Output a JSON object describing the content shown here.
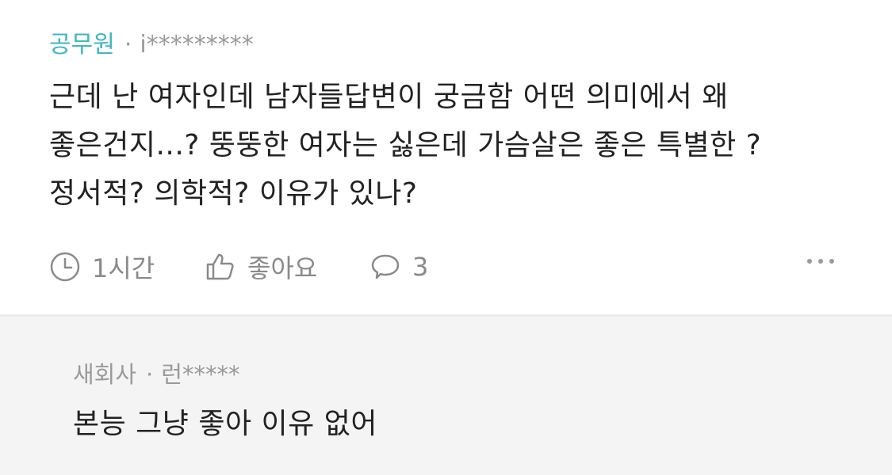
{
  "post": {
    "author_job": "공무원",
    "separator": "·",
    "author_id": "i*********",
    "body_lines": [
      "근데 난 여자인데 남자들답변이 궁금함 어떤 의미에서 왜",
      "좋은건지...? 뚱뚱한 여자는 싫은데 가슴살은 좋은 특별한 ?",
      "정서적? 의학적? 이유가 있나?"
    ],
    "time": "1시간",
    "like_label": "좋아요",
    "comment_count": "3",
    "icons": {
      "time": "clock-icon",
      "like": "thumbs-up-icon",
      "comment": "speech-bubble-icon",
      "more": "more-dots-icon"
    }
  },
  "reply": {
    "author_job": "새회사",
    "separator": "·",
    "author_id": "런*****",
    "body": "본능 그냥 좋아 이유 없어"
  },
  "colors": {
    "accent": "#3fb7c0",
    "meta_gray": "#9a9a9a",
    "icon_gray": "#8a8a8a",
    "text": "#222222",
    "reply_bg": "#f4f4f4"
  }
}
